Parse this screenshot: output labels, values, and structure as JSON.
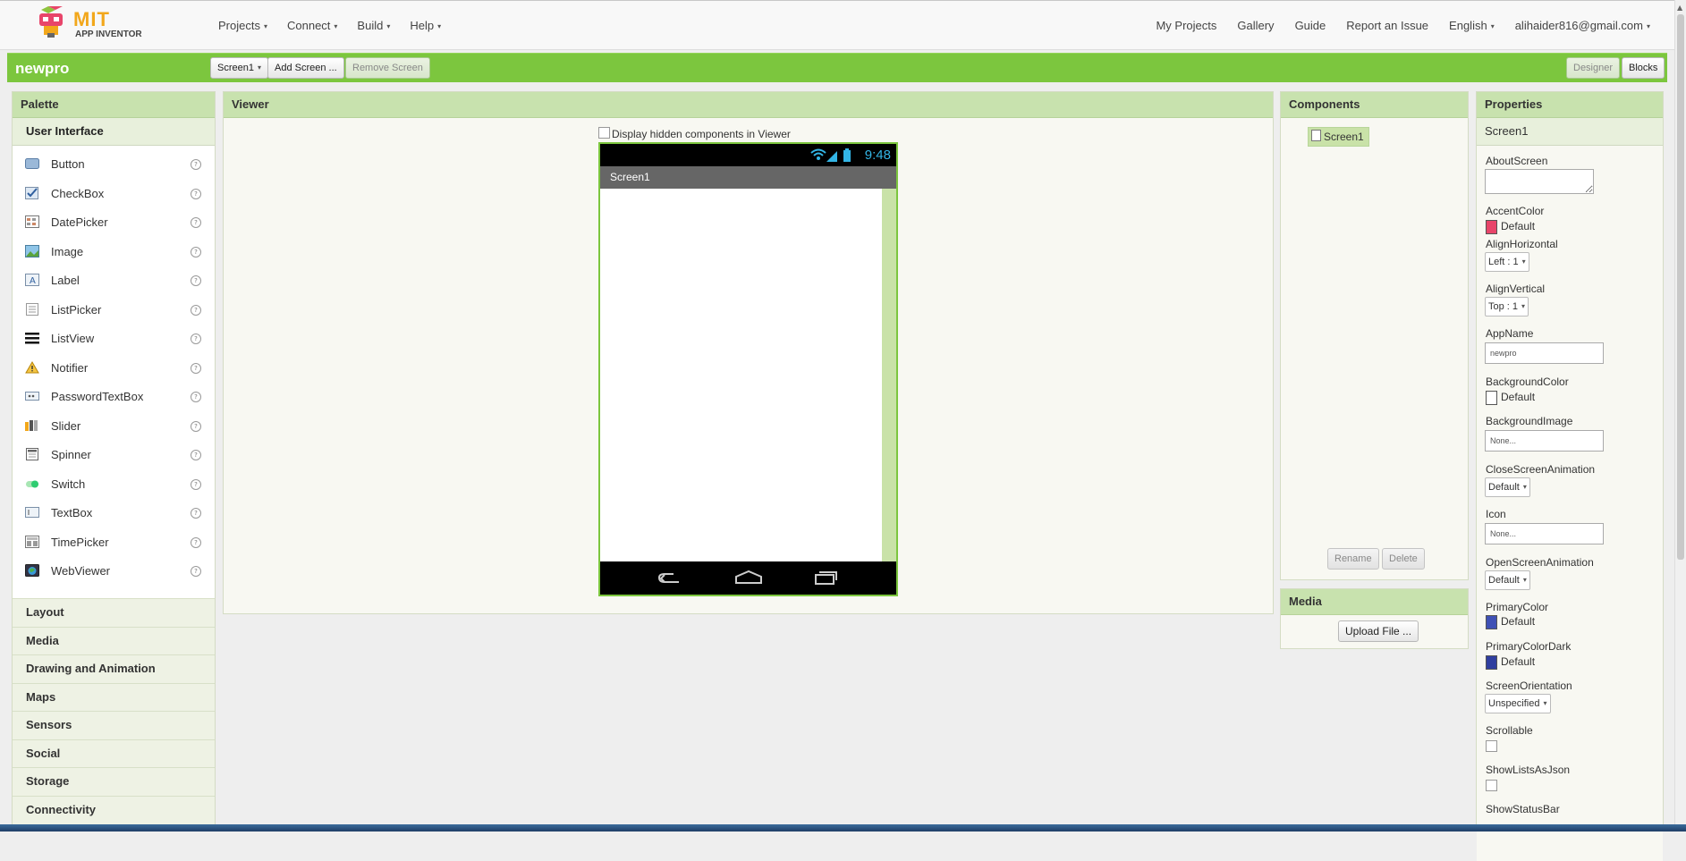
{
  "header": {
    "logo_title": "MIT",
    "logo_subtitle": "APP INVENTOR",
    "nav_left": [
      {
        "label": "Projects"
      },
      {
        "label": "Connect"
      },
      {
        "label": "Build"
      },
      {
        "label": "Help"
      }
    ],
    "nav_right": [
      {
        "label": "My Projects"
      },
      {
        "label": "Gallery"
      },
      {
        "label": "Guide"
      },
      {
        "label": "Report an Issue"
      },
      {
        "label": "English"
      },
      {
        "label": "alihaider816@gmail.com"
      }
    ]
  },
  "project_bar": {
    "name": "newpro",
    "screen_select": "Screen1",
    "add_screen": "Add Screen ...",
    "remove_screen": "Remove Screen",
    "designer": "Designer",
    "blocks": "Blocks"
  },
  "palette": {
    "title": "Palette",
    "open_category": "User Interface",
    "items": [
      {
        "label": "Button",
        "icon": "button-icon"
      },
      {
        "label": "CheckBox",
        "icon": "checkbox-icon"
      },
      {
        "label": "DatePicker",
        "icon": "datepicker-icon"
      },
      {
        "label": "Image",
        "icon": "image-icon"
      },
      {
        "label": "Label",
        "icon": "label-icon"
      },
      {
        "label": "ListPicker",
        "icon": "listpicker-icon"
      },
      {
        "label": "ListView",
        "icon": "listview-icon"
      },
      {
        "label": "Notifier",
        "icon": "notifier-icon"
      },
      {
        "label": "PasswordTextBox",
        "icon": "password-icon"
      },
      {
        "label": "Slider",
        "icon": "slider-icon"
      },
      {
        "label": "Spinner",
        "icon": "spinner-icon"
      },
      {
        "label": "Switch",
        "icon": "switch-icon"
      },
      {
        "label": "TextBox",
        "icon": "textbox-icon"
      },
      {
        "label": "TimePicker",
        "icon": "timepicker-icon"
      },
      {
        "label": "WebViewer",
        "icon": "webviewer-icon"
      }
    ],
    "help_glyph": "?",
    "categories": [
      "Layout",
      "Media",
      "Drawing and Animation",
      "Maps",
      "Sensors",
      "Social",
      "Storage",
      "Connectivity"
    ]
  },
  "viewer": {
    "title": "Viewer",
    "hidden_components_label": "Display hidden components in Viewer",
    "status_time": "9:48",
    "screen_title": "Screen1"
  },
  "components": {
    "title": "Components",
    "root": "Screen1",
    "rename": "Rename",
    "delete": "Delete"
  },
  "media": {
    "title": "Media",
    "upload": "Upload File ..."
  },
  "properties": {
    "title": "Properties",
    "component": "Screen1",
    "about_screen": {
      "label": "AboutScreen",
      "value": ""
    },
    "accent_color": {
      "label": "AccentColor",
      "value": "Default",
      "color": "#e8456a"
    },
    "align_horizontal": {
      "label": "AlignHorizontal",
      "value": "Left : 1"
    },
    "align_vertical": {
      "label": "AlignVertical",
      "value": "Top : 1"
    },
    "app_name": {
      "label": "AppName",
      "value": "newpro"
    },
    "background_color": {
      "label": "BackgroundColor",
      "value": "Default",
      "color": "#ffffff"
    },
    "background_image": {
      "label": "BackgroundImage",
      "value": "None..."
    },
    "close_screen_animation": {
      "label": "CloseScreenAnimation",
      "value": "Default"
    },
    "icon": {
      "label": "Icon",
      "value": "None..."
    },
    "open_screen_animation": {
      "label": "OpenScreenAnimation",
      "value": "Default"
    },
    "primary_color": {
      "label": "PrimaryColor",
      "value": "Default",
      "color": "#3f51b5"
    },
    "primary_color_dark": {
      "label": "PrimaryColorDark",
      "value": "Default",
      "color": "#303f9f"
    },
    "screen_orientation": {
      "label": "ScreenOrientation",
      "value": "Unspecified"
    },
    "scrollable": {
      "label": "Scrollable",
      "checked": false
    },
    "show_lists_as_json": {
      "label": "ShowListsAsJson",
      "checked": false
    },
    "show_status_bar": {
      "label": "ShowStatusBar"
    }
  },
  "colors": {
    "accent_green": "#7cc63e",
    "panel_header": "#c8e2ae",
    "clock_blue": "#33b5e5"
  }
}
